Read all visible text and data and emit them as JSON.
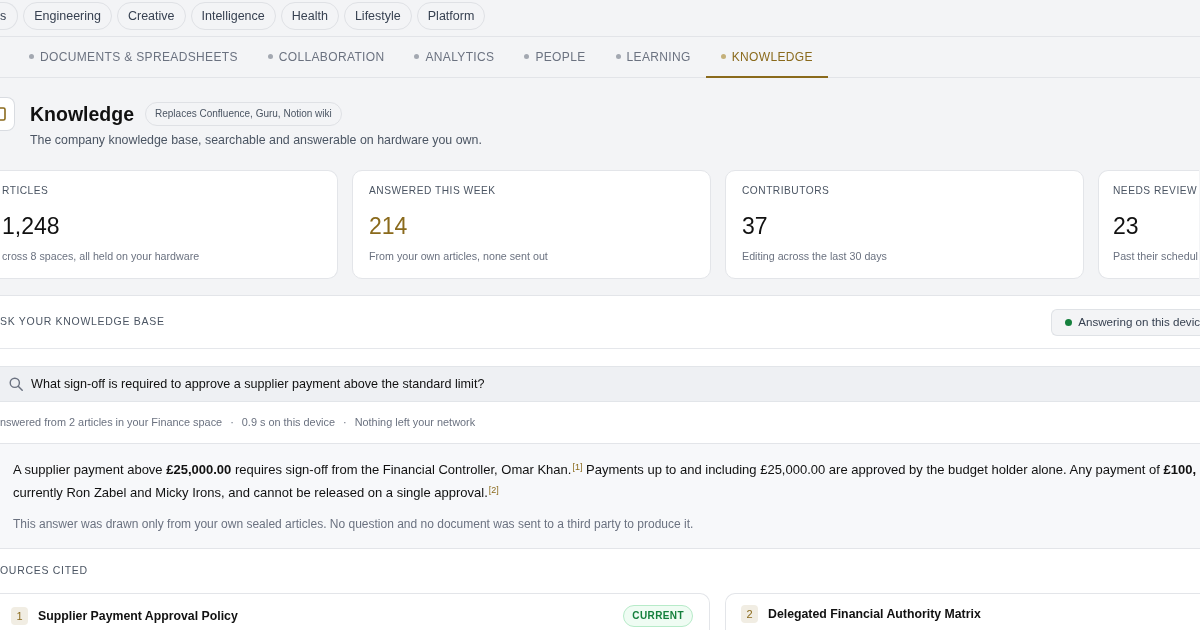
{
  "category_pills": [
    {
      "label": "s",
      "selected": false
    },
    {
      "label": "Engineering",
      "selected": false
    },
    {
      "label": "Creative",
      "selected": false
    },
    {
      "label": "Intelligence",
      "selected": false
    },
    {
      "label": "Health",
      "selected": false
    },
    {
      "label": "Lifestyle",
      "selected": false
    },
    {
      "label": "Platform",
      "selected": false
    }
  ],
  "section_tabs": [
    {
      "label": "DOCUMENTS & SPREADSHEETS",
      "selected": false
    },
    {
      "label": "COLLABORATION",
      "selected": false
    },
    {
      "label": "ANALYTICS",
      "selected": false
    },
    {
      "label": "PEOPLE",
      "selected": false
    },
    {
      "label": "LEARNING",
      "selected": false
    },
    {
      "label": "KNOWLEDGE",
      "selected": true
    }
  ],
  "header": {
    "title": "Knowledge",
    "tag": "Replaces Confluence, Guru, Notion wiki",
    "subtitle": "The company knowledge base, searchable and answerable on hardware you own."
  },
  "stats": [
    {
      "label": "RTICLES",
      "value": "1,248",
      "note": "cross 8 spaces, all held on your hardware",
      "kind": "plain"
    },
    {
      "label": "ANSWERED THIS WEEK",
      "value": "214",
      "note": "From your own articles, none sent out",
      "kind": "highlight"
    },
    {
      "label": "CONTRIBUTORS",
      "value": "37",
      "note": "Editing across the last 30 days",
      "kind": "plain"
    },
    {
      "label": "NEEDS REVIEW",
      "value": "23",
      "note": "Past their schedul",
      "kind": "plain"
    }
  ],
  "ask": {
    "title": "SK YOUR KNOWLEDGE BASE",
    "status": {
      "label": "Answering on this devic",
      "active": true
    },
    "query": {
      "value": "What sign-off is required to approve a supplier payment above the standard limit?"
    },
    "meta": {
      "items": [
        "nswered from 2 articles in your Finance space",
        "0.9 s on this device",
        "Nothing left your network"
      ],
      "separator": "·"
    },
    "answer": {
      "lines": [
        "A supplier payment above **£25,000.00** requires sign-off from the Financial Controller, Omar Khan.$^{[1]}$ Payments up to and including £25,000.00 are approved by the budget holder alone. Any payment of **£100,**",
        "currently Ron Zabel and Micky Irons, and cannot be released on a single approval.$^{[2]}$"
      ],
      "note": "This answer was drawn only from your own sealed articles. No question and no document was sent to a third party to produce it."
    }
  },
  "sources": {
    "title": "OURCES CITED",
    "items": [
      {
        "number": "1",
        "title": "Supplier Payment Approval Policy",
        "status": "CURRENT"
      },
      {
        "number": "2",
        "title": "Delegated Financial Authority Matrix"
      }
    ]
  }
}
